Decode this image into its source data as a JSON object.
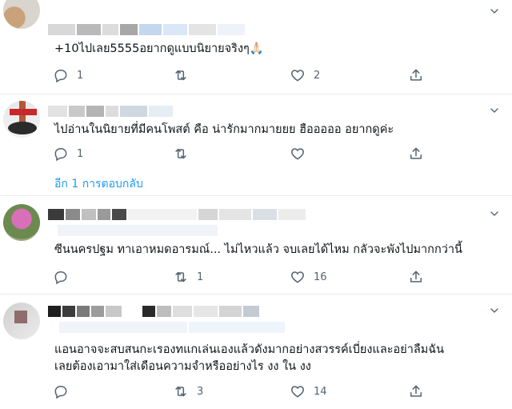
{
  "tweets": [
    {
      "text": "+10ไปเลย5555อยากดูแบบนิยายจริงๆ🙏🏻",
      "replies": "1",
      "retweets": "",
      "likes": "2"
    },
    {
      "text": "ไปอ่านในนิยายที่มีคนโพสต์ คือ น่ารักมากมายยย ฮือออออ อยากดูค่ะ",
      "replies": "1",
      "retweets": "",
      "likes": "",
      "thread_link": "อีก 1 การตอบกลับ"
    },
    {
      "text": "ซีนนครปฐม ทาเอาหมดอารมณ์... ไม่ไหวแล้ว  จบเลยได้ไหม  กลัวจะพังไปมากกว่านี้",
      "replies": "",
      "retweets": "1",
      "likes": "16"
    },
    {
      "text1": "แอนอาจจะสบสนกะเรองทแกเล่นเองแล้วดังมากอย่างสวรรค์เบี่ยงและอย่าลืมฉัน",
      "text2": "เลยต้องเอามาใส่เดือนความจำหรืออย่างไร งง ใน งง",
      "replies": "",
      "retweets": "3",
      "likes": "14"
    }
  ],
  "icons": [
    "reply-icon",
    "retweet-icon",
    "like-icon",
    "share-icon",
    "chevron-down-icon"
  ],
  "colors": {
    "link": "#1d9bf0",
    "icon": "#536471",
    "separator": "#e6ecf0"
  }
}
